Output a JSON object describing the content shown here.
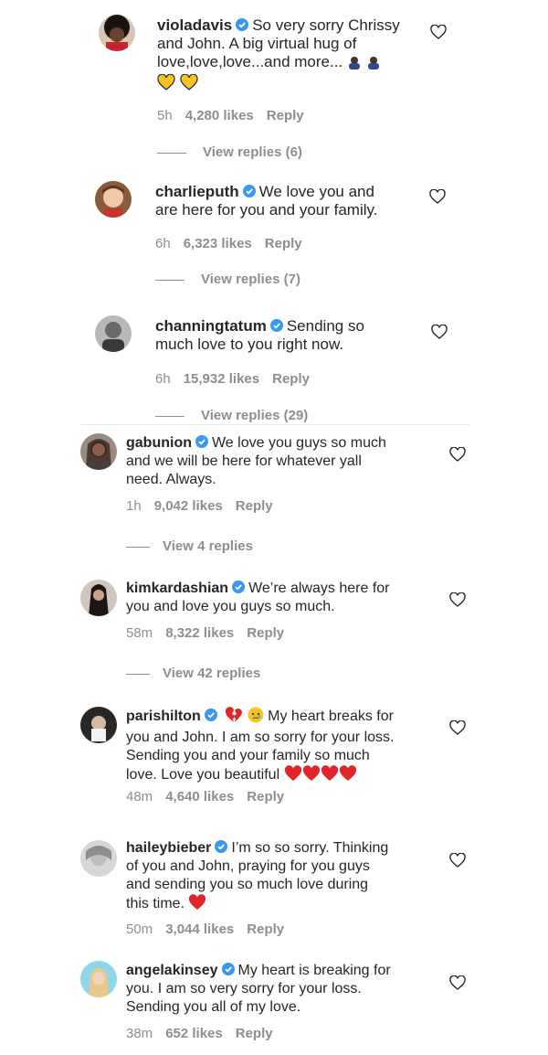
{
  "comments": [
    {
      "username": "violadavis",
      "lines": [
        "So very sorry Chrissy",
        "and John. A big virtual hug of",
        "love,love,love...and more..."
      ],
      "time": "5h",
      "likes": "4,280 likes",
      "reply": "Reply",
      "view_replies": "View replies (6)"
    },
    {
      "username": "charlieputh",
      "lines": [
        "We love you and",
        "are here for you and your family."
      ],
      "time": "6h",
      "likes": "6,323 likes",
      "reply": "Reply",
      "view_replies": "View replies (7)"
    },
    {
      "username": "channingtatum",
      "lines": [
        "Sending so",
        "much love to you right now."
      ],
      "time": "6h",
      "likes": "15,932 likes",
      "reply": "Reply",
      "view_replies": "View replies (29)"
    },
    {
      "username": "gabunion",
      "lines": [
        "We love you guys so much",
        "and we will be here for whatever yall",
        "need. Always."
      ],
      "time": "1h",
      "likes": "9,042 likes",
      "reply": "Reply",
      "view_replies": "View 4 replies"
    },
    {
      "username": "kimkardashian",
      "lines": [
        "We’re always here for",
        "you and love you guys so much."
      ],
      "time": "58m",
      "likes": "8,322 likes",
      "reply": "Reply",
      "view_replies": "View 42 replies"
    },
    {
      "username": "parishilton",
      "lines": [
        "My heart breaks for",
        "you and John. I am so sorry for your loss.",
        "Sending you and your family so much",
        "love. Love you beautiful"
      ],
      "time": "48m",
      "likes": "4,640 likes",
      "reply": "Reply"
    },
    {
      "username": "haileybieber",
      "lines": [
        "I’m so so sorry. Thinking",
        "of you and John, praying for you guys",
        "and sending you so much love during",
        "this time."
      ],
      "time": "50m",
      "likes": "3,044 likes",
      "reply": "Reply"
    },
    {
      "username": "angelakinsey",
      "lines": [
        "My heart is breaking for",
        "you. I am so very sorry for your loss.",
        "Sending you all of my love."
      ],
      "time": "38m",
      "likes": "652 likes",
      "reply": "Reply"
    }
  ],
  "icons": {
    "verified": "verified-badge-icon",
    "like": "heart-outline-icon"
  },
  "colors": {
    "verified": "#3897f0",
    "meta": "#8e8e8e",
    "red_heart": "#e0262b",
    "yellow_heart": "#f7c325"
  }
}
